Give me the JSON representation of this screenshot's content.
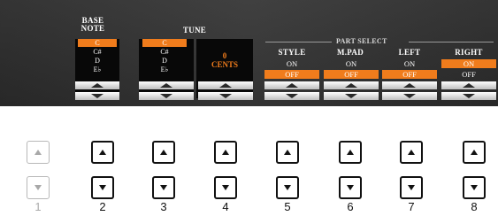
{
  "headers": {
    "base_note_1": "BASE",
    "base_note_2": "NOTE",
    "tune": "TUNE",
    "part_select": "PART SELECT",
    "style": "STYLE",
    "mpad": "M.PAD",
    "left": "LEFT",
    "right": "RIGHT"
  },
  "base_note": {
    "items": [
      "C",
      "C#",
      "D",
      "E♭"
    ],
    "selected": "C"
  },
  "tune": {
    "items": [
      "C",
      "C#",
      "D",
      "E♭"
    ],
    "selected": "C",
    "value": "0",
    "unit": "CENTS"
  },
  "parts": {
    "style": {
      "on": "ON",
      "off": "OFF",
      "selected": "OFF"
    },
    "mpad": {
      "on": "ON",
      "off": "OFF",
      "selected": "OFF"
    },
    "left": {
      "on": "ON",
      "off": "OFF",
      "selected": "OFF"
    },
    "right": {
      "on": "ON",
      "off": "OFF",
      "selected": "ON"
    }
  },
  "panel_numbers": [
    "1",
    "2",
    "3",
    "4",
    "5",
    "6",
    "7",
    "8"
  ],
  "colors": {
    "selected": "#f07c1c",
    "lcd_bg": "#333333",
    "list_bg": "#080808"
  },
  "icons": {
    "up": "triangle-up-icon",
    "down": "triangle-down-icon"
  }
}
